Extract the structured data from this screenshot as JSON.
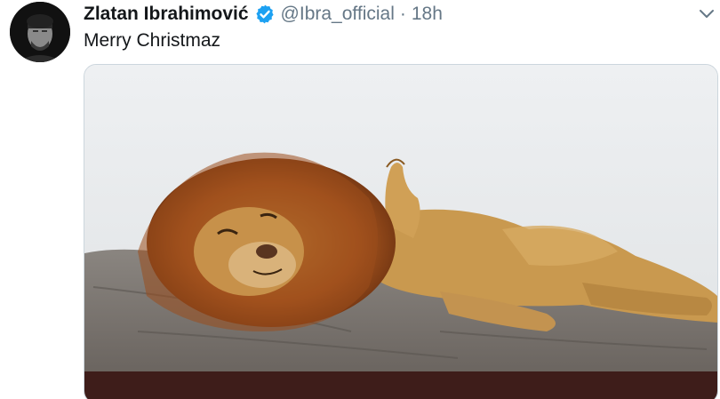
{
  "tweet": {
    "author_name": "Zlatan Ibrahimović",
    "handle": "@Ibra_official",
    "separator": "·",
    "time": "18h",
    "text": "Merry Christmaz",
    "verified": true,
    "avatar_icon": "profile-photo",
    "menu_icon": "chevron-down-icon",
    "media_icon": "lion-photo"
  },
  "colors": {
    "name": "#14171a",
    "secondary": "#657786",
    "verified_badge": "#1da1f2",
    "media_bottom_band": "#3e1d1a"
  }
}
